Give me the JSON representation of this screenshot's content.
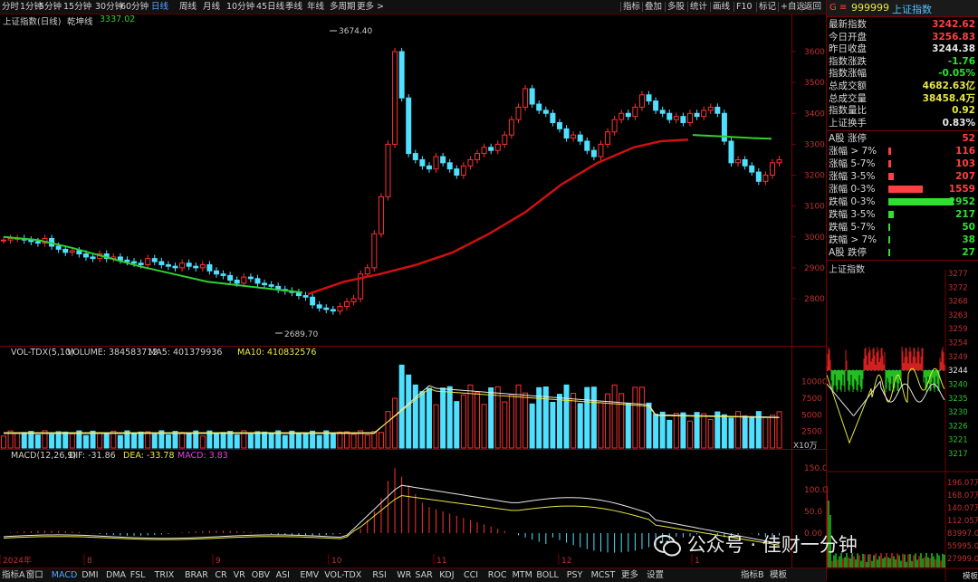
{
  "toolbar": {
    "periods": [
      "分时",
      "1分钟",
      "5分钟",
      "15分钟",
      "30分钟",
      "60分钟",
      "日线",
      "周线",
      "月线",
      "10分钟",
      "45日线",
      "季线",
      "年线",
      "多周期",
      "更多 >"
    ],
    "active_period": "日线",
    "tools": [
      "指标",
      "叠加",
      "多股",
      "统计",
      "画线",
      "F10",
      "标记",
      "+自选",
      "返回"
    ]
  },
  "main_chart": {
    "title": "上证指数(日线)",
    "indicator_label": "乾坤线",
    "indicator_value": "3337.02",
    "high_label": "3674.40",
    "low_label": "2689.70",
    "y_ticks": [
      "3600",
      "3500",
      "3400",
      "3300",
      "3200",
      "3100",
      "3000",
      "2900",
      "2800"
    ]
  },
  "volume_pane": {
    "label": "VOL-TDX(5,10)",
    "volume_text": "VOLUME: 384583712",
    "ma5_text": "MA5: 401379936",
    "ma10_text": "MA10: 410832576",
    "y_ticks": [
      "10000",
      "7500",
      "5000",
      "2500"
    ],
    "unit": "X10万"
  },
  "macd_pane": {
    "label": "MACD(12,26,9)",
    "dif_text": "DIF: -31.86",
    "dea_text": "DEA: -33.78",
    "macd_text": "MACD: 3.83",
    "y_ticks": [
      "150.0",
      "100.0",
      "50.0",
      "0.00"
    ]
  },
  "x_axis": {
    "labels": [
      "2024年",
      "8",
      "9",
      "10",
      "11",
      "12",
      "1"
    ]
  },
  "quote_panel": {
    "code": "999999",
    "name": "上证指数",
    "rows": [
      {
        "label": "最新指数",
        "value": "3242.62",
        "color": "#ff4040"
      },
      {
        "label": "今日开盘",
        "value": "3256.83",
        "color": "#ff4040"
      },
      {
        "label": "昨日收盘",
        "value": "3244.38",
        "color": "#e8e8e8"
      },
      {
        "label": "指数涨跌",
        "value": "-1.76",
        "color": "#30e030"
      },
      {
        "label": "指数涨幅",
        "value": "-0.05%",
        "color": "#30e030"
      },
      {
        "label": "总成交额",
        "value": "4682.63亿",
        "color": "#e8e840"
      },
      {
        "label": "总成交量",
        "value": "38458.4万",
        "color": "#e8e840"
      },
      {
        "label": "指数量比",
        "value": "0.92",
        "color": "#e8e840"
      },
      {
        "label": "上证换手",
        "value": "0.83%",
        "color": "#e8e8e8"
      }
    ],
    "breadth": [
      {
        "label": "A股 涨停",
        "value": "52",
        "color": "#ff4040",
        "fraction": 0.0
      },
      {
        "label": "涨幅 > 7%",
        "value": "116",
        "color": "#ff4040",
        "fraction": 0.04
      },
      {
        "label": "涨幅 5-7%",
        "value": "103",
        "color": "#ff4040",
        "fraction": 0.04
      },
      {
        "label": "涨幅 3-5%",
        "value": "207",
        "color": "#ff4040",
        "fraction": 0.08
      },
      {
        "label": "涨幅 0-3%",
        "value": "1559",
        "color": "#ff4040",
        "fraction": 0.53
      },
      {
        "label": "跌幅 0-3%",
        "value": "2952",
        "color": "#30e030",
        "fraction": 1.0
      },
      {
        "label": "跌幅 3-5%",
        "value": "217",
        "color": "#30e030",
        "fraction": 0.08
      },
      {
        "label": "跌幅 5-7%",
        "value": "50",
        "color": "#30e030",
        "fraction": 0.02
      },
      {
        "label": "跌幅 > 7%",
        "value": "38",
        "color": "#30e030",
        "fraction": 0.02
      },
      {
        "label": "A股 跌停",
        "value": "27",
        "color": "#30e030",
        "fraction": 0.01
      }
    ],
    "intraday_title": "上证指数",
    "intraday_y_ticks": [
      "3277",
      "3272",
      "3268",
      "3263",
      "3259",
      "3254",
      "3249",
      "3244",
      "3240",
      "3235",
      "3230",
      "3226",
      "3221",
      "3217"
    ],
    "intraday_vol_ticks": [
      "196.07万",
      "168.07万",
      "140.07万",
      "112.05万",
      "83997.0",
      "55995.0",
      "27999.0"
    ],
    "intraday_tabs": [
      "日线",
      "模板"
    ]
  },
  "bottom_tabs": {
    "items": [
      "指标A",
      "窗口",
      "MACD",
      "DMI",
      "DMA",
      "FSL",
      "TRIX",
      "BRAR",
      "CR",
      "VR",
      "OBV",
      "ASI",
      "EMV",
      "VOL-TDX",
      "RSI",
      "WR",
      "SAR",
      "KDJ",
      "CCI",
      "ROC",
      "MTM",
      "BOLL",
      "PSY",
      "MCST",
      "更多",
      "设置"
    ],
    "active": "MACD",
    "right": [
      "指标B",
      "模板"
    ]
  },
  "watermark": "公众号 · 佳财一分钟",
  "colors": {
    "up": "#ff3030",
    "down": "#50e0ff",
    "ma_green": "#30d030",
    "ma_red": "#d01010",
    "axis": "#7a0000"
  }
}
